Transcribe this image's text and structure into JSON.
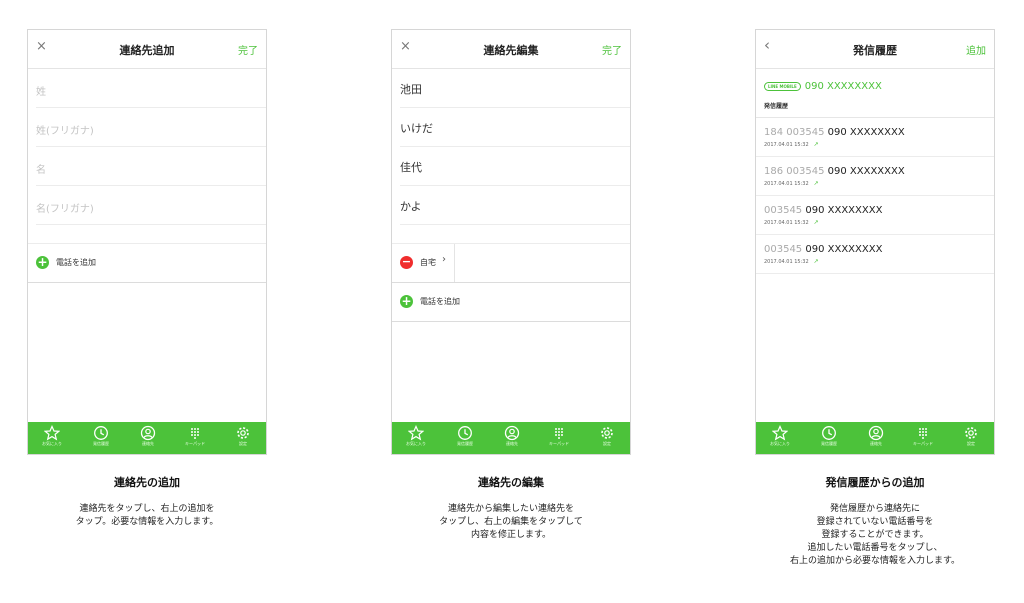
{
  "colors": {
    "accent": "#4cc23a",
    "remove": "#f02d2d"
  },
  "tabs": [
    {
      "icon": "star-icon",
      "label": "お気に入り"
    },
    {
      "icon": "clock-icon",
      "label": "発信履歴"
    },
    {
      "icon": "person-icon",
      "label": "連絡先"
    },
    {
      "icon": "keypad-icon",
      "label": "キーパッド"
    },
    {
      "icon": "gear-icon",
      "label": "設定"
    }
  ],
  "screen1": {
    "left": "×",
    "title": "連絡先追加",
    "right": "完了",
    "fields": [
      "姓",
      "姓(フリガナ)",
      "名",
      "名(フリガナ)"
    ],
    "add_phone": "電話を追加"
  },
  "screen2": {
    "left": "×",
    "title": "連絡先編集",
    "right": "完了",
    "fields": [
      "池田",
      "いけだ",
      "佳代",
      "かよ"
    ],
    "phone_type": "自宅",
    "add_phone": "電話を追加"
  },
  "screen3": {
    "left": "‹",
    "title": "発信履歴",
    "right": "追加",
    "badge": "LINE MOBILE",
    "own_number": "090 XXXXXXXX",
    "section": "発信履歴",
    "history": [
      {
        "prefix": "184 003545 ",
        "number": "090 XXXXXXXX",
        "time": "2017.04.01 15:32"
      },
      {
        "prefix": "186 003545 ",
        "number": "090 XXXXXXXX",
        "time": "2017.04.01 15:32"
      },
      {
        "prefix": "003545 ",
        "number": "090 XXXXXXXX",
        "time": "2017.04.01 15:32"
      },
      {
        "prefix": "003545 ",
        "number": "090 XXXXXXXX",
        "time": "2017.04.01 15:32"
      }
    ]
  },
  "captions": [
    {
      "title": "連絡先の追加",
      "lines": [
        "連絡先をタップし、右上の追加を",
        "タップ。必要な情報を入力します。"
      ]
    },
    {
      "title": "連絡先の編集",
      "lines": [
        "連絡先から編集したい連絡先を",
        "タップし、右上の編集をタップして",
        "内容を修正します。"
      ]
    },
    {
      "title": "発信履歴からの追加",
      "lines": [
        "発信履歴から連絡先に",
        "登録されていない電話番号を",
        "登録することができます。",
        "追加したい電話番号をタップし、",
        "右上の追加から必要な情報を入力します。"
      ]
    }
  ]
}
